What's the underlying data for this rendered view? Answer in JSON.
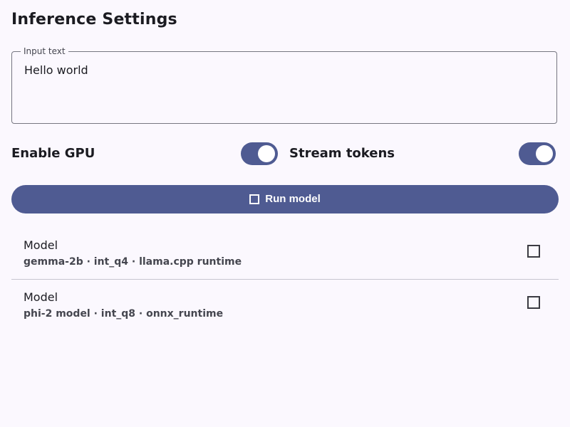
{
  "header": {
    "title": "Inference Settings"
  },
  "prompt_field": {
    "label": "Input text",
    "value": "Hello world"
  },
  "toggles": [
    {
      "label": "Enable GPU",
      "checked": true
    },
    {
      "label": "Stream tokens",
      "checked": true
    }
  ],
  "primary_action": {
    "label": "Run model",
    "icon": "play-icon"
  },
  "models": [
    {
      "title": "Model",
      "subtitle": "gemma-2b · int_q4 · llama.cpp runtime",
      "action_icon": "checkbox-icon"
    },
    {
      "title": "Model",
      "subtitle": "phi-2 model · int_q8 · onnx_runtime",
      "action_icon": "checkbox-icon"
    }
  ],
  "colors": {
    "background": "#fbf8fe",
    "primary": "#4f5b92",
    "text": "#1b1b21",
    "divider": "#c6c5d0"
  }
}
